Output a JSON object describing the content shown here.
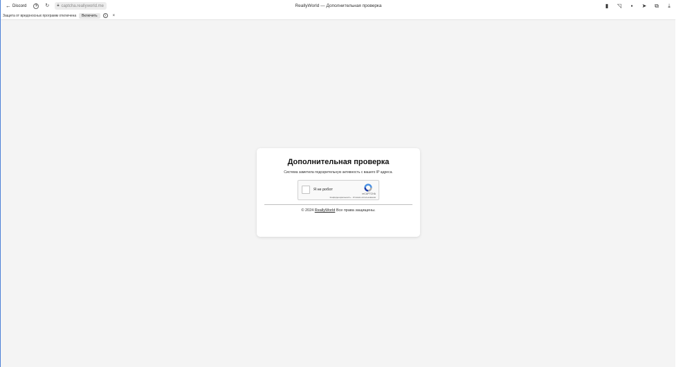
{
  "browser": {
    "back_label": "Discord",
    "url": "captcha.reallyworld.me",
    "tab_title": "ReallyWorld — Дополнительная проверка"
  },
  "infobar": {
    "message": "Защита от вредоносных программ отключена",
    "enable_label": "Включить",
    "help": "?",
    "close": "×"
  },
  "card": {
    "title": "Дополнительная проверка",
    "subtitle": "Система заметила подозрительную активность с вашего IP адреса.",
    "recaptcha": {
      "label": "Я не робот",
      "brand": "reCAPTCHA",
      "links": "Конфиденциальность - Условия использования"
    },
    "footer": {
      "prefix": "© 2024",
      "link": "ReallyWorld",
      "suffix": "Все права защищены."
    }
  },
  "colors": {
    "page_bg": "#f4f4f4",
    "card_bg": "#ffffff",
    "window_border": "#4a7fd6"
  }
}
